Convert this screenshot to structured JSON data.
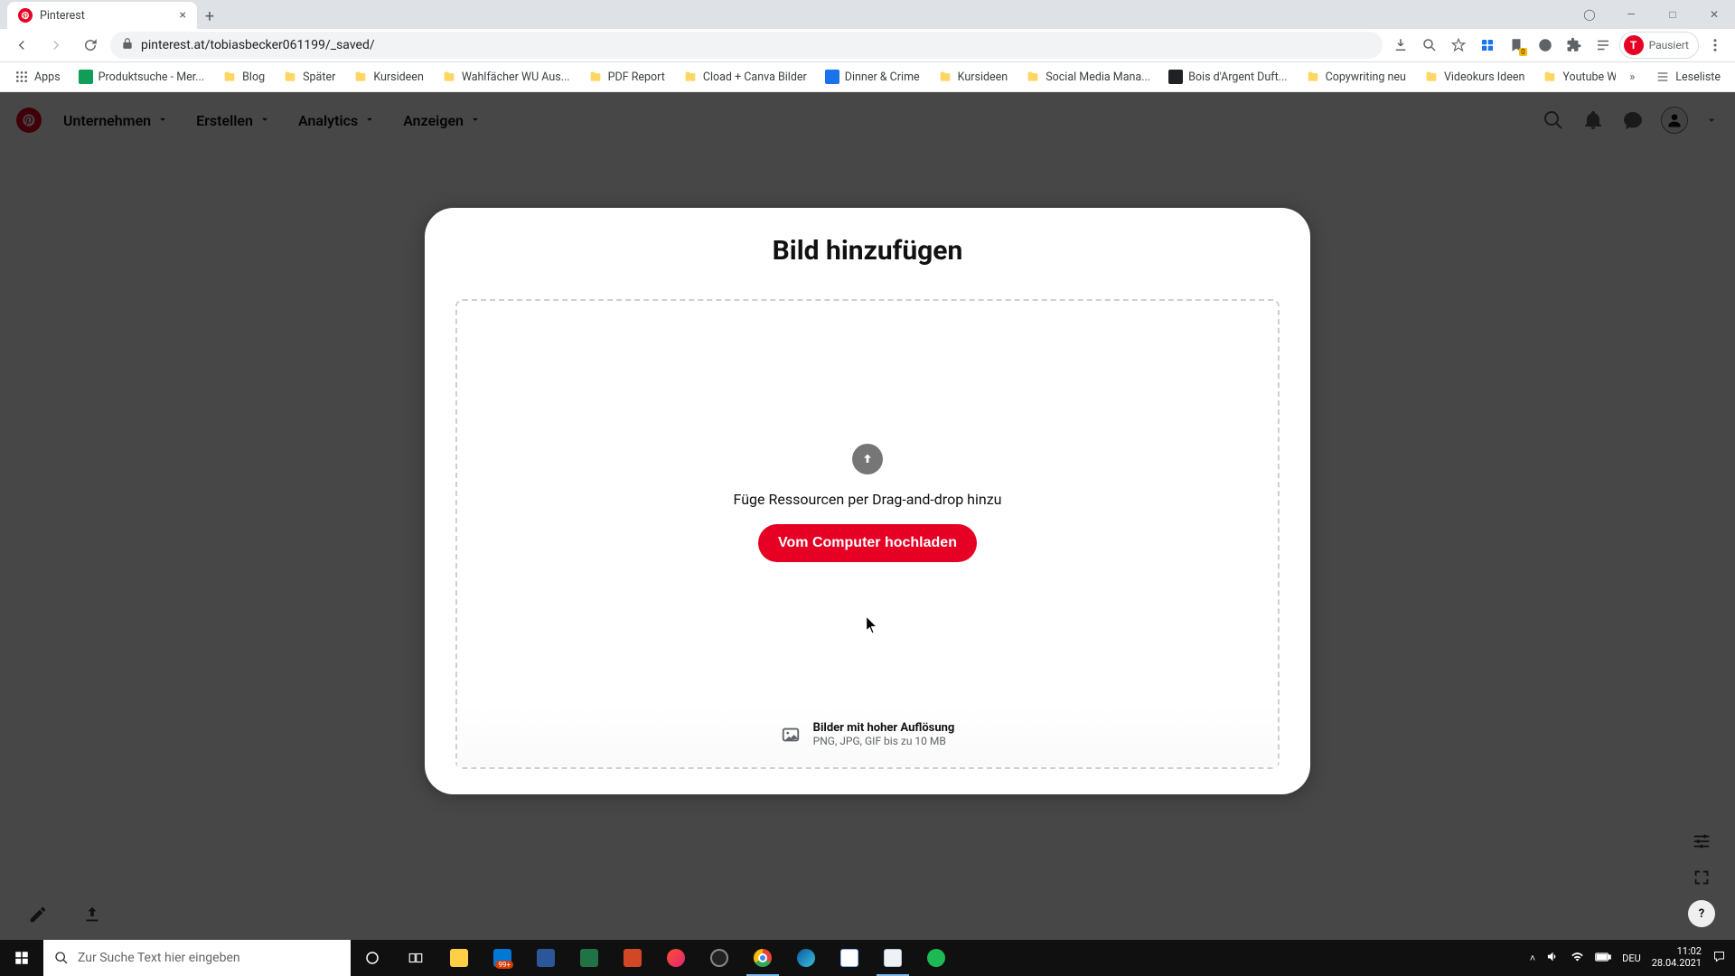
{
  "browser": {
    "tab_title": "Pinterest",
    "url": "pinterest.at/tobiasbecker061199/_saved/",
    "paused_label": "Pausiert",
    "avatar_initial": "T",
    "apps_label": "Apps",
    "reading_list_label": "Leseliste"
  },
  "bookmarks": [
    {
      "label": "Produktsuche - Mer...",
      "color": "#0f9d58"
    },
    {
      "label": "Blog",
      "folder": true
    },
    {
      "label": "Später",
      "folder": true
    },
    {
      "label": "Kursideen",
      "folder": true
    },
    {
      "label": "Wahlfächer WU Aus...",
      "folder": true
    },
    {
      "label": "PDF Report",
      "folder": true
    },
    {
      "label": "Cload + Canva Bilder",
      "folder": true
    },
    {
      "label": "Dinner & Crime",
      "color": "#1a73e8"
    },
    {
      "label": "Kursideen",
      "folder": true
    },
    {
      "label": "Social Media Mana...",
      "folder": true
    },
    {
      "label": "Bois d'Argent Duft...",
      "color": "#202124"
    },
    {
      "label": "Copywriting neu",
      "folder": true
    },
    {
      "label": "Videokurs Ideen",
      "folder": true
    },
    {
      "label": "Youtube WICHTIG",
      "folder": true
    }
  ],
  "pinterest_nav": {
    "items": [
      "Unternehmen",
      "Erstellen",
      "Analytics",
      "Anzeigen"
    ]
  },
  "modal": {
    "title": "Bild hinzufügen",
    "drag_text": "Füge Ressourcen per Drag-and-drop hinzu",
    "upload_button": "Vom Computer hochladen",
    "footer_title": "Bilder mit hoher Auflösung",
    "footer_sub": "PNG, JPG, GIF bis zu 10 MB"
  },
  "taskbar": {
    "search_placeholder": "Zur Suche Text hier eingeben",
    "lang": "DEU",
    "time": "11:02",
    "date": "28.04.2021"
  },
  "help_label": "?"
}
